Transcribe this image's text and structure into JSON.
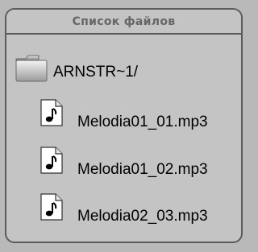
{
  "panel": {
    "title": "Список файлов"
  },
  "items": [
    {
      "type": "folder",
      "label": "ARNSTR~1/",
      "icon": "folder-icon"
    },
    {
      "type": "file",
      "label": "Melodia01_01.mp3",
      "icon": "music-file-icon"
    },
    {
      "type": "file",
      "label": "Melodia01_02.mp3",
      "icon": "music-file-icon"
    },
    {
      "type": "file",
      "label": "Melodia02_03.mp3",
      "icon": "music-file-icon"
    }
  ],
  "colors": {
    "background": "#b9b9b9",
    "panel": "#c4c4c4",
    "border": "#5b5b5b",
    "title_text": "#666666"
  }
}
